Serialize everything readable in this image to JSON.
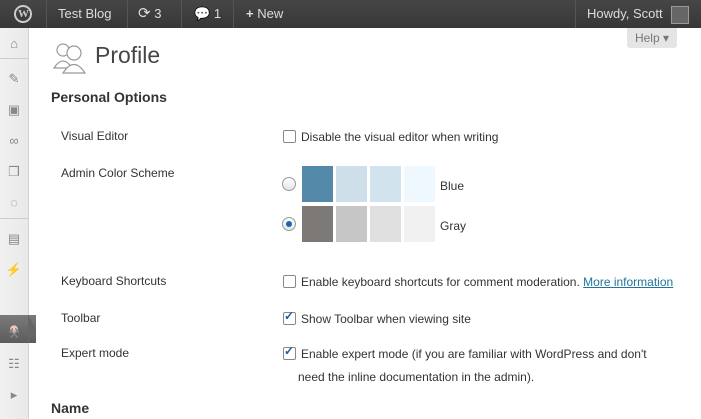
{
  "adminbar": {
    "site_name": "Test Blog",
    "updates_count": "3",
    "comments_count": "1",
    "new_label": "New",
    "howdy": "Howdy, Scott"
  },
  "help": {
    "label": "Help ▾"
  },
  "page": {
    "title": "Profile"
  },
  "personal_options": {
    "heading": "Personal Options",
    "visual_editor": {
      "label": "Visual Editor",
      "option": "Disable the visual editor when writing",
      "checked": false
    },
    "color_scheme": {
      "label": "Admin Color Scheme",
      "schemes": [
        {
          "name": "Blue",
          "selected": false,
          "colors": [
            "#5589aa",
            "#cfdfe9",
            "#d1e4ee",
            "#eff8ff"
          ]
        },
        {
          "name": "Gray",
          "selected": true,
          "colors": [
            "#7c7976",
            "#c6c6c6",
            "#e0e0e0",
            "#f1f1f1"
          ]
        }
      ]
    },
    "keyboard_shortcuts": {
      "label": "Keyboard Shortcuts",
      "option": "Enable keyboard shortcuts for comment moderation.",
      "link": "More information",
      "checked": false
    },
    "toolbar": {
      "label": "Toolbar",
      "option": "Show Toolbar when viewing site",
      "checked": true
    },
    "expert_mode": {
      "label": "Expert mode",
      "option_line1": "Enable expert mode (if you are familiar with WordPress and don't",
      "option_line2": "need the inline documentation in the admin).",
      "checked": true
    }
  },
  "name_section": {
    "heading": "Name"
  }
}
